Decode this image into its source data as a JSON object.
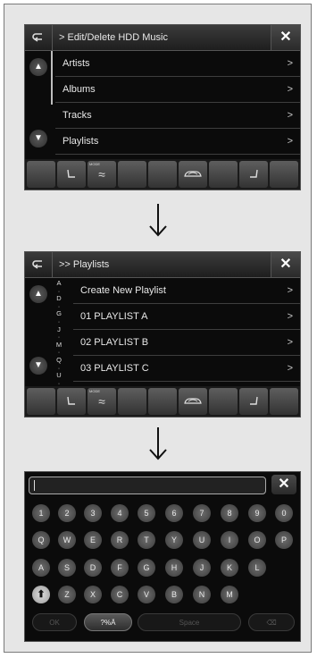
{
  "screen1": {
    "back_icon": "back-arrow-icon",
    "title": "> Edit/Delete HDD Music",
    "close_label": "✕",
    "scroll_up_label": "▲",
    "scroll_down_label": "▼",
    "items": [
      {
        "label": "Artists",
        "chevron": ">"
      },
      {
        "label": "Albums",
        "chevron": ">"
      },
      {
        "label": "Tracks",
        "chevron": ">"
      },
      {
        "label": "Playlists",
        "chevron": ">"
      }
    ]
  },
  "screen2": {
    "back_icon": "back-arrow-icon",
    "title": ">> Playlists",
    "close_label": "✕",
    "scroll_up_label": "▲",
    "scroll_down_label": "▼",
    "alpha_index": "A\nD\nG\nJ\nM\nQ\nU\nZ",
    "items": [
      {
        "label": "Create New Playlist",
        "chevron": ">"
      },
      {
        "label": "01 PLAYLIST A",
        "chevron": ">"
      },
      {
        "label": "02 PLAYLIST B",
        "chevron": ">"
      },
      {
        "label": "03 PLAYLIST C",
        "chevron": ">"
      }
    ]
  },
  "bottom_bar": {
    "buttons": [
      {
        "icon": "blank",
        "label": ""
      },
      {
        "icon": "seat-heater-icon",
        "label": ""
      },
      {
        "icon": "mode-fan-icon",
        "label": "MODE",
        "glyph": "≈"
      },
      {
        "icon": "blank",
        "label": ""
      },
      {
        "icon": "blank",
        "label": ""
      },
      {
        "icon": "recirculation-car-icon",
        "label": ""
      },
      {
        "icon": "blank",
        "label": ""
      },
      {
        "icon": "seat-heater-icon",
        "label": ""
      },
      {
        "icon": "blank",
        "label": ""
      }
    ]
  },
  "keyboard": {
    "input_value": "",
    "close_label": "✕",
    "rows": [
      [
        "1",
        "2",
        "3",
        "4",
        "5",
        "6",
        "7",
        "8",
        "9",
        "0"
      ],
      [
        "Q",
        "W",
        "E",
        "R",
        "T",
        "Y",
        "U",
        "I",
        "O",
        "P"
      ],
      [
        "A",
        "S",
        "D",
        "F",
        "G",
        "H",
        "J",
        "K",
        "L"
      ],
      [
        "⬆",
        "Z",
        "X",
        "C",
        "V",
        "B",
        "N",
        "M"
      ]
    ],
    "function_keys": {
      "ok": "OK",
      "symbols": "?%Ä",
      "space": "Space",
      "delete": "⌫"
    }
  },
  "arrow_icon": "down-arrow-icon"
}
